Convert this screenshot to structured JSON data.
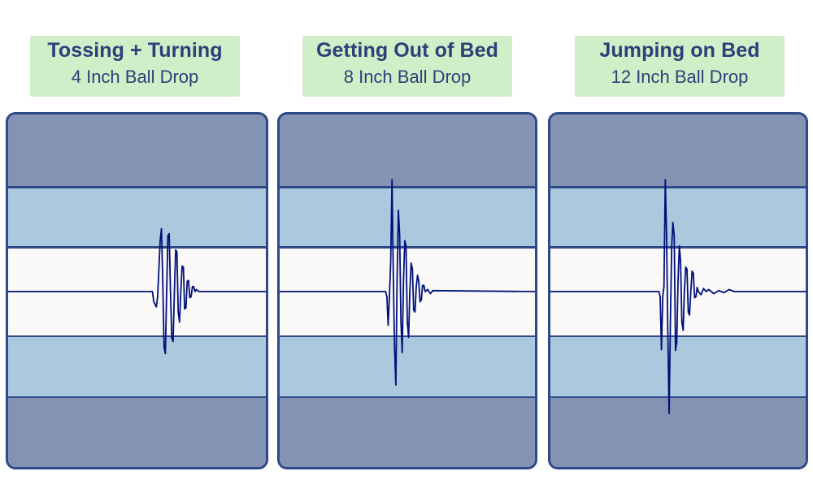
{
  "chart_data": [
    {
      "type": "line",
      "title": "Tossing + Turning",
      "subtitle": "4 Inch Ball Drop",
      "xlabel": "",
      "ylabel": "",
      "grid": false,
      "ylim": [
        -1.0,
        1.0
      ],
      "amplitude_scale": "relative vibration amplitude (center band = ±0.45, outer light bands = ±0.8)",
      "series": [
        {
          "name": "vibration",
          "color": "#00107a",
          "points": [
            [
              0,
              0
            ],
            [
              0.56,
              0
            ],
            [
              0.565,
              -0.1
            ],
            [
              0.575,
              -0.15
            ],
            [
              0.58,
              -0.05
            ],
            [
              0.59,
              0.5
            ],
            [
              0.595,
              0.62
            ],
            [
              0.6,
              0.1
            ],
            [
              0.605,
              -0.55
            ],
            [
              0.61,
              -0.61
            ],
            [
              0.615,
              0.0
            ],
            [
              0.62,
              0.55
            ],
            [
              0.625,
              0.57
            ],
            [
              0.63,
              0.0
            ],
            [
              0.635,
              -0.46
            ],
            [
              0.64,
              -0.49
            ],
            [
              0.645,
              0.0
            ],
            [
              0.65,
              0.41
            ],
            [
              0.655,
              0.39
            ],
            [
              0.66,
              -0.2
            ],
            [
              0.665,
              -0.3
            ],
            [
              0.67,
              0.0
            ],
            [
              0.675,
              0.25
            ],
            [
              0.68,
              0.24
            ],
            [
              0.685,
              -0.17
            ],
            [
              0.69,
              -0.16
            ],
            [
              0.695,
              0.1
            ],
            [
              0.7,
              0.11
            ],
            [
              0.705,
              -0.06
            ],
            [
              0.71,
              -0.05
            ],
            [
              0.715,
              0.05
            ],
            [
              0.72,
              0.05
            ],
            [
              0.725,
              0.0
            ],
            [
              0.73,
              0.02
            ],
            [
              0.74,
              0.0
            ],
            [
              1,
              0
            ]
          ]
        }
      ]
    },
    {
      "type": "line",
      "title": "Getting Out of Bed",
      "subtitle": "8 Inch Ball Drop",
      "xlabel": "",
      "ylabel": "",
      "grid": false,
      "ylim": [
        -1.0,
        1.0
      ],
      "amplitude_scale": "relative vibration amplitude (center band = ±0.45, outer light bands = ±0.8)",
      "series": [
        {
          "name": "vibration",
          "color": "#00107a",
          "points": [
            [
              0,
              0
            ],
            [
              0.415,
              0
            ],
            [
              0.42,
              -0.05
            ],
            [
              0.425,
              -0.33
            ],
            [
              0.43,
              -0.05
            ],
            [
              0.435,
              0.3
            ],
            [
              0.44,
              1.1
            ],
            [
              0.445,
              0.2
            ],
            [
              0.45,
              -0.55
            ],
            [
              0.455,
              -0.92
            ],
            [
              0.46,
              0.1
            ],
            [
              0.465,
              0.8
            ],
            [
              0.47,
              0.55
            ],
            [
              0.475,
              -0.3
            ],
            [
              0.48,
              -0.6
            ],
            [
              0.485,
              0.1
            ],
            [
              0.49,
              0.5
            ],
            [
              0.495,
              0.45
            ],
            [
              0.5,
              -0.3
            ],
            [
              0.505,
              -0.45
            ],
            [
              0.51,
              0.0
            ],
            [
              0.515,
              0.28
            ],
            [
              0.52,
              0.22
            ],
            [
              0.525,
              -0.18
            ],
            [
              0.53,
              -0.2
            ],
            [
              0.535,
              0.05
            ],
            [
              0.54,
              0.16
            ],
            [
              0.545,
              0.1
            ],
            [
              0.55,
              -0.1
            ],
            [
              0.555,
              -0.08
            ],
            [
              0.56,
              0.06
            ],
            [
              0.565,
              0.06
            ],
            [
              0.57,
              0.0
            ],
            [
              0.58,
              0.02
            ],
            [
              0.59,
              -0.02
            ],
            [
              0.6,
              0.01
            ],
            [
              1,
              0
            ]
          ]
        }
      ]
    },
    {
      "type": "line",
      "title": "Jumping on Bed",
      "subtitle": "12 Inch Ball Drop",
      "xlabel": "",
      "ylabel": "",
      "grid": false,
      "ylim": [
        -1.2,
        1.2
      ],
      "amplitude_scale": "relative vibration amplitude (center band = ±0.45, outer light bands = ±0.8)",
      "series": [
        {
          "name": "vibration",
          "color": "#00107a",
          "points": [
            [
              0,
              0
            ],
            [
              0.425,
              0
            ],
            [
              0.43,
              -0.05
            ],
            [
              0.435,
              -0.57
            ],
            [
              0.44,
              -0.05
            ],
            [
              0.445,
              0.05
            ],
            [
              0.45,
              1.1
            ],
            [
              0.455,
              0.55
            ],
            [
              0.46,
              -0.4
            ],
            [
              0.465,
              -1.2
            ],
            [
              0.47,
              -0.3
            ],
            [
              0.475,
              0.45
            ],
            [
              0.48,
              0.68
            ],
            [
              0.485,
              0.55
            ],
            [
              0.49,
              -0.58
            ],
            [
              0.495,
              -0.5
            ],
            [
              0.5,
              0.1
            ],
            [
              0.505,
              0.45
            ],
            [
              0.51,
              0.3
            ],
            [
              0.515,
              -0.3
            ],
            [
              0.52,
              -0.38
            ],
            [
              0.525,
              0.0
            ],
            [
              0.53,
              0.24
            ],
            [
              0.535,
              0.22
            ],
            [
              0.54,
              -0.2
            ],
            [
              0.545,
              -0.23
            ],
            [
              0.55,
              0.0
            ],
            [
              0.555,
              0.2
            ],
            [
              0.56,
              0.18
            ],
            [
              0.565,
              -0.06
            ],
            [
              0.57,
              -0.05
            ],
            [
              0.575,
              0.04
            ],
            [
              0.58,
              0.0
            ],
            [
              0.59,
              -0.03
            ],
            [
              0.6,
              0.03
            ],
            [
              0.61,
              0.0
            ],
            [
              0.62,
              0.02
            ],
            [
              0.64,
              -0.02
            ],
            [
              0.66,
              0.01
            ],
            [
              0.68,
              -0.01
            ],
            [
              0.7,
              0.02
            ],
            [
              0.72,
              0.0
            ],
            [
              1,
              0
            ]
          ]
        }
      ]
    }
  ],
  "colors": {
    "label_background": "#d0eec7",
    "label_text": "#2d3f78",
    "panel_border": "#2e4a86",
    "outer_band": "#8492b4",
    "mid_band": "#abc9de",
    "center_band": "#fbf8f8",
    "waveform": "#00107a"
  }
}
